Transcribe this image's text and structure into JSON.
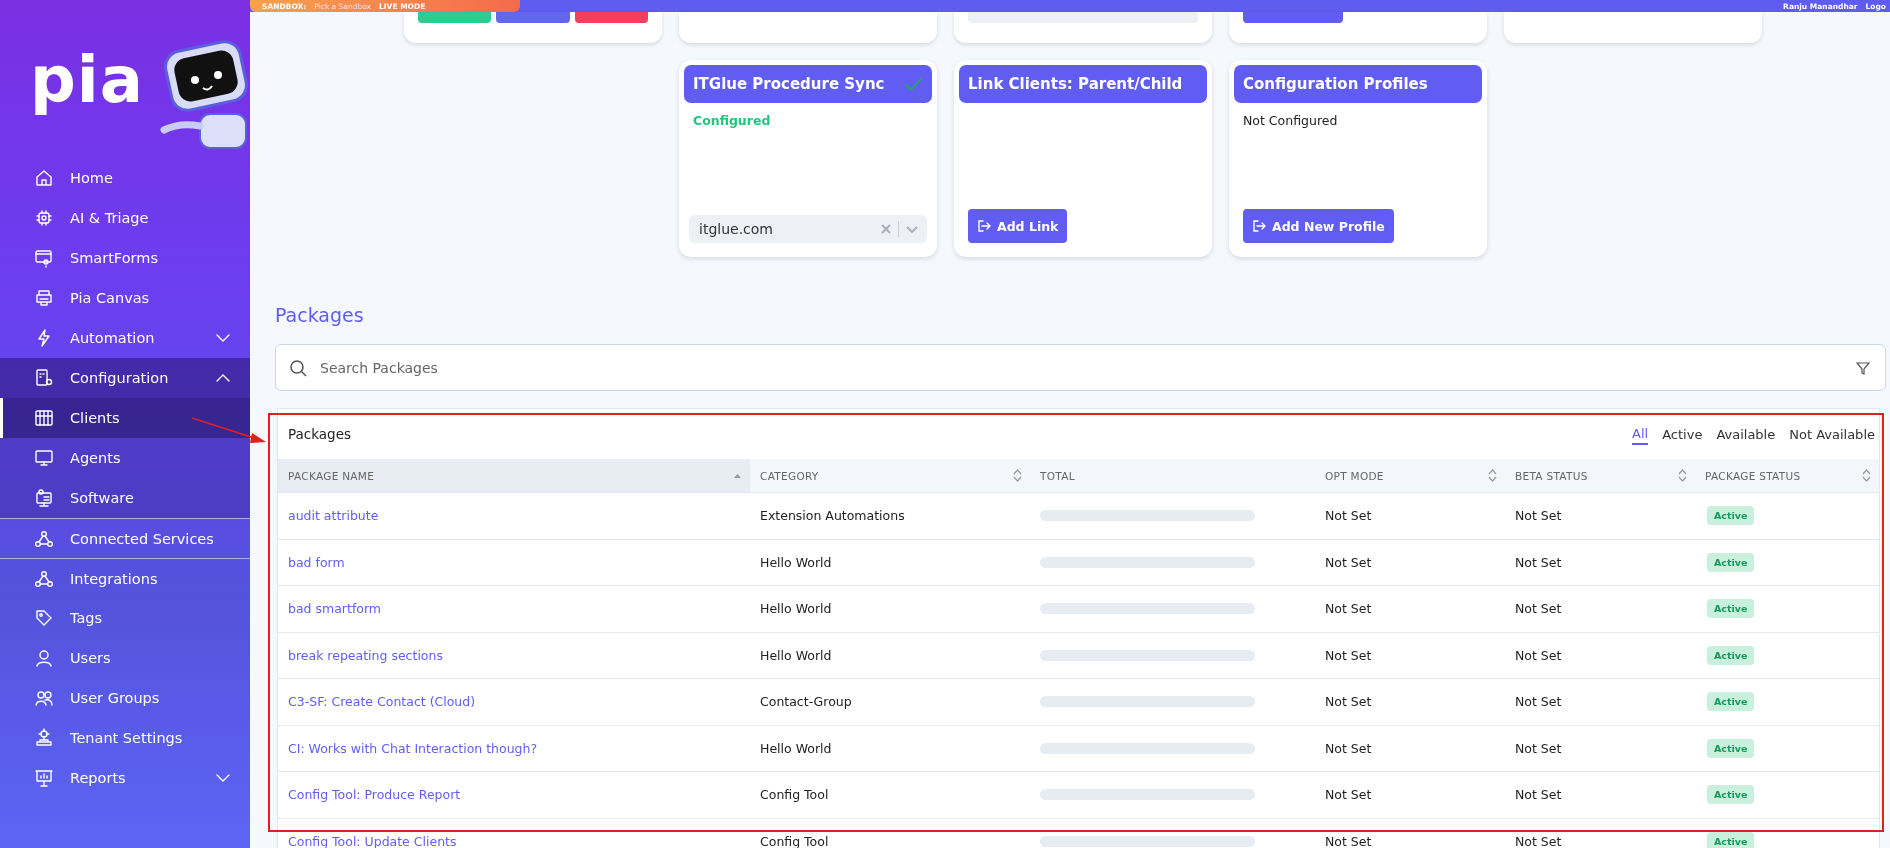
{
  "topbar": {
    "sandbox_label": "SANDBOX:",
    "sandbox_value": "Pick a Sandbox",
    "mode": "LIVE MODE",
    "user": "Ranju Manandhar",
    "logout": "Logo"
  },
  "sidebar": {
    "logo": "pia",
    "items": [
      {
        "label": "Home",
        "selected": false
      },
      {
        "label": "AI & Triage",
        "selected": false
      },
      {
        "label": "SmartForms",
        "selected": false
      },
      {
        "label": "Pia Canvas",
        "selected": false
      },
      {
        "label": "Automation",
        "selected": false,
        "expanded": false
      },
      {
        "label": "Configuration",
        "selected": false,
        "expanded": true,
        "children": [
          {
            "label": "Clients",
            "selected": true
          },
          {
            "label": "Agents",
            "selected": false
          },
          {
            "label": "Software",
            "selected": false
          }
        ]
      },
      {
        "label": "Connected Services",
        "selected": false
      },
      {
        "label": "Integrations",
        "selected": false
      },
      {
        "label": "Tags",
        "selected": false
      },
      {
        "label": "Users",
        "selected": false
      },
      {
        "label": "User Groups",
        "selected": false
      },
      {
        "label": "Tenant Settings",
        "selected": false
      },
      {
        "label": "Reports",
        "selected": false,
        "expanded": false
      }
    ]
  },
  "top_cards": [
    {
      "kind": "buttons",
      "buttons": [
        {
          "color": "#2ecc8f"
        },
        {
          "color": "#6366f1"
        },
        {
          "color": "#f43f5e"
        }
      ]
    },
    {
      "kind": "empty"
    },
    {
      "kind": "field"
    },
    {
      "kind": "button"
    },
    {
      "kind": "empty"
    }
  ],
  "cards": [
    {
      "title": "ITGlue Procedure Sync",
      "configured": true,
      "status": "Configured",
      "select": {
        "value": "itglue.com"
      }
    },
    {
      "title": "Link Clients: Parent/Child",
      "button": "Add Link"
    },
    {
      "title": "Configuration Profiles",
      "configured": false,
      "status": "Not Configured",
      "button": "Add New Profile"
    }
  ],
  "packages": {
    "heading": "Packages",
    "search": {
      "placeholder": "Search Packages"
    },
    "table": {
      "title": "Packages",
      "filters": [
        {
          "label": "All",
          "selected": true
        },
        {
          "label": "Active",
          "selected": false
        },
        {
          "label": "Available",
          "selected": false
        },
        {
          "label": "Not Available",
          "selected": false
        }
      ],
      "columns": [
        {
          "label": "PACKAGE NAME",
          "sortable": true,
          "sorted": true
        },
        {
          "label": "CATEGORY",
          "sortable": true,
          "sorted": false
        },
        {
          "label": "TOTAL",
          "sortable": false,
          "sorted": false
        },
        {
          "label": "OPT MODE",
          "sortable": true,
          "sorted": false
        },
        {
          "label": "BETA STATUS",
          "sortable": true,
          "sorted": false
        },
        {
          "label": "PACKAGE STATUS",
          "sortable": true,
          "sorted": false
        }
      ],
      "rows": [
        {
          "name": "audit attribute",
          "category": "Extension Automations",
          "opt_mode": "Not Set",
          "beta_status": "Not Set",
          "status": "Active"
        },
        {
          "name": "bad form",
          "category": "Hello World",
          "opt_mode": "Not Set",
          "beta_status": "Not Set",
          "status": "Active"
        },
        {
          "name": "bad smartform",
          "category": "Hello World",
          "opt_mode": "Not Set",
          "beta_status": "Not Set",
          "status": "Active"
        },
        {
          "name": "break repeating sections",
          "category": "Hello World",
          "opt_mode": "Not Set",
          "beta_status": "Not Set",
          "status": "Active"
        },
        {
          "name": "C3-SF: Create Contact (Cloud)",
          "category": "Contact-Group",
          "opt_mode": "Not Set",
          "beta_status": "Not Set",
          "status": "Active"
        },
        {
          "name": "CI: Works with Chat Interaction though?",
          "category": "Hello World",
          "opt_mode": "Not Set",
          "beta_status": "Not Set",
          "status": "Active"
        },
        {
          "name": "Config Tool: Produce Report",
          "category": "Config Tool",
          "opt_mode": "Not Set",
          "beta_status": "Not Set",
          "status": "Active"
        },
        {
          "name": "Config Tool: Update Clients",
          "category": "Config Tool",
          "opt_mode": "Not Set",
          "beta_status": "Not Set",
          "status": "Active"
        }
      ]
    }
  }
}
